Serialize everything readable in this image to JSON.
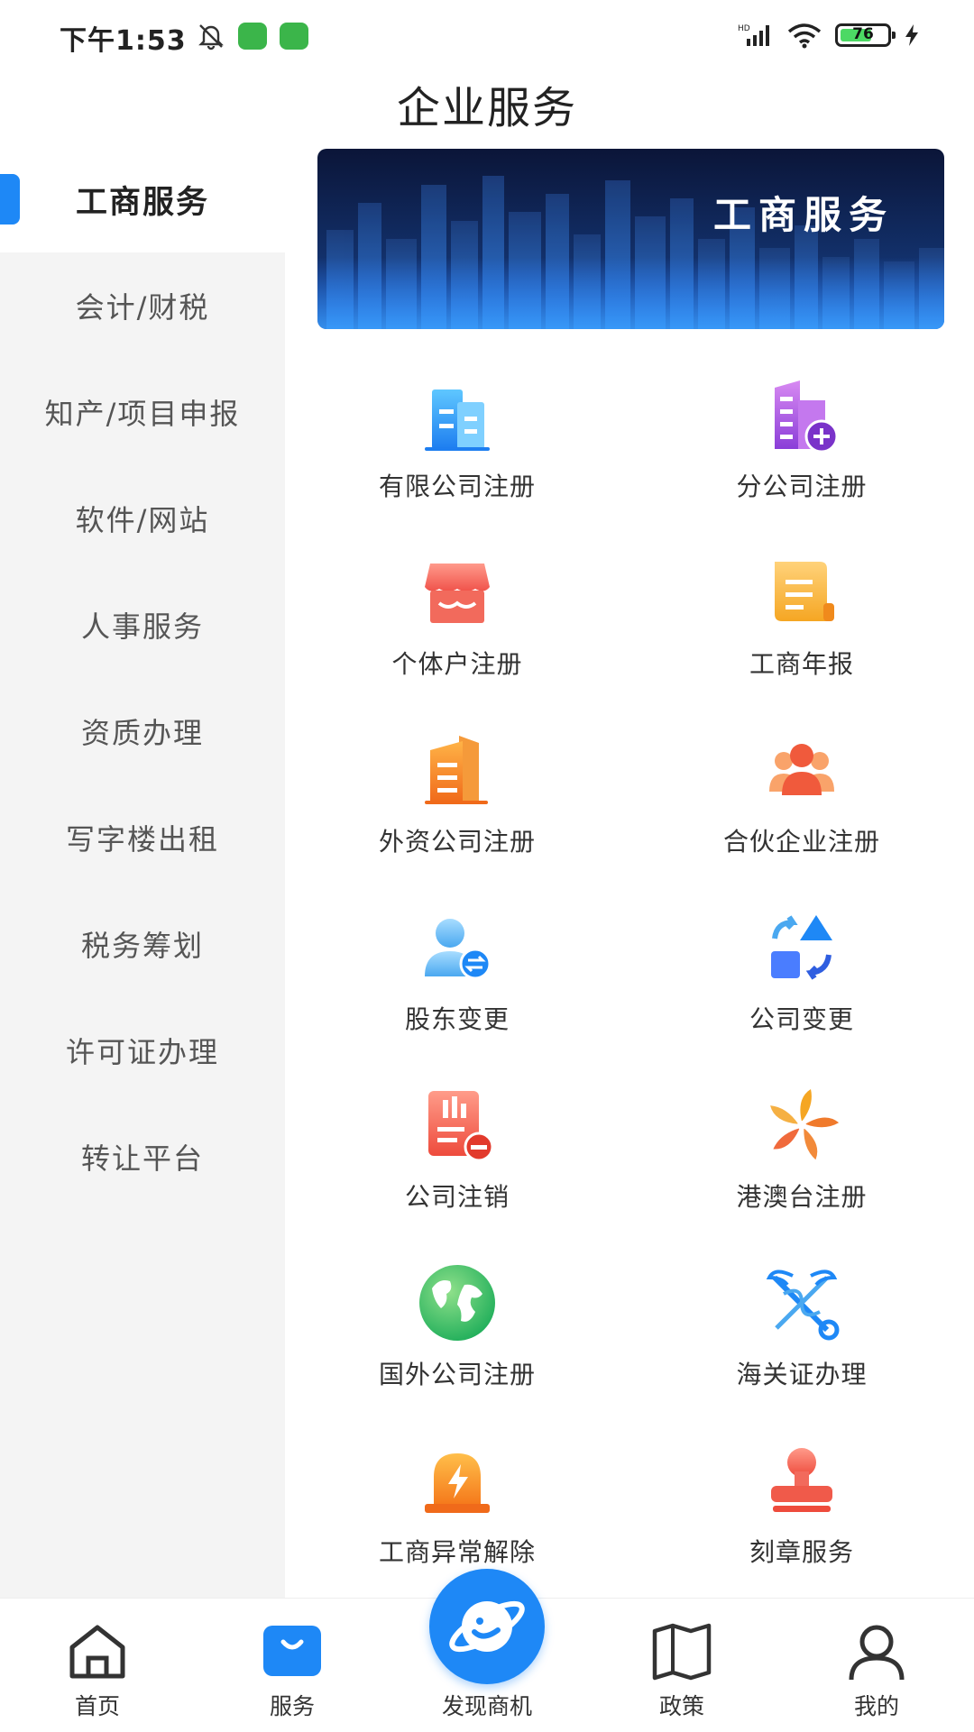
{
  "status_bar": {
    "time": "下午1:53",
    "battery": "76"
  },
  "page_title": "企业服务",
  "sidebar": {
    "items": [
      {
        "label": "工商服务",
        "active": true
      },
      {
        "label": "会计/财税"
      },
      {
        "label": "知产/项目申报"
      },
      {
        "label": "软件/网站"
      },
      {
        "label": "人事服务"
      },
      {
        "label": "资质办理"
      },
      {
        "label": "写字楼出租"
      },
      {
        "label": "税务筹划"
      },
      {
        "label": "许可证办理"
      },
      {
        "label": "转让平台"
      }
    ]
  },
  "banner": {
    "text": "工商服务"
  },
  "services": [
    {
      "label": "有限公司注册",
      "icon": "building-icon"
    },
    {
      "label": "分公司注册",
      "icon": "building-plus-icon"
    },
    {
      "label": "个体户注册",
      "icon": "shop-icon"
    },
    {
      "label": "工商年报",
      "icon": "scroll-icon"
    },
    {
      "label": "外资公司注册",
      "icon": "office-icon"
    },
    {
      "label": "合伙企业注册",
      "icon": "group-icon"
    },
    {
      "label": "股东变更",
      "icon": "user-exchange-icon"
    },
    {
      "label": "公司变更",
      "icon": "shapes-icon"
    },
    {
      "label": "公司注销",
      "icon": "building-minus-icon"
    },
    {
      "label": "港澳台注册",
      "icon": "bauhinia-icon"
    },
    {
      "label": "国外公司注册",
      "icon": "globe-icon"
    },
    {
      "label": "海关证办理",
      "icon": "caduceus-key-icon"
    },
    {
      "label": "工商异常解除",
      "icon": "alarm-icon"
    },
    {
      "label": "刻章服务",
      "icon": "stamp-icon"
    }
  ],
  "tabbar": {
    "items": [
      {
        "label": "首页",
        "icon": "home-icon"
      },
      {
        "label": "服务",
        "icon": "bag-icon",
        "active": true
      },
      {
        "label": "发现商机",
        "icon": "planet-icon"
      },
      {
        "label": "政策",
        "icon": "book-icon"
      },
      {
        "label": "我的",
        "icon": "user-icon"
      }
    ]
  },
  "colors": {
    "accent": "#1e88f6",
    "sidebar_bg": "#f4f4f4"
  }
}
